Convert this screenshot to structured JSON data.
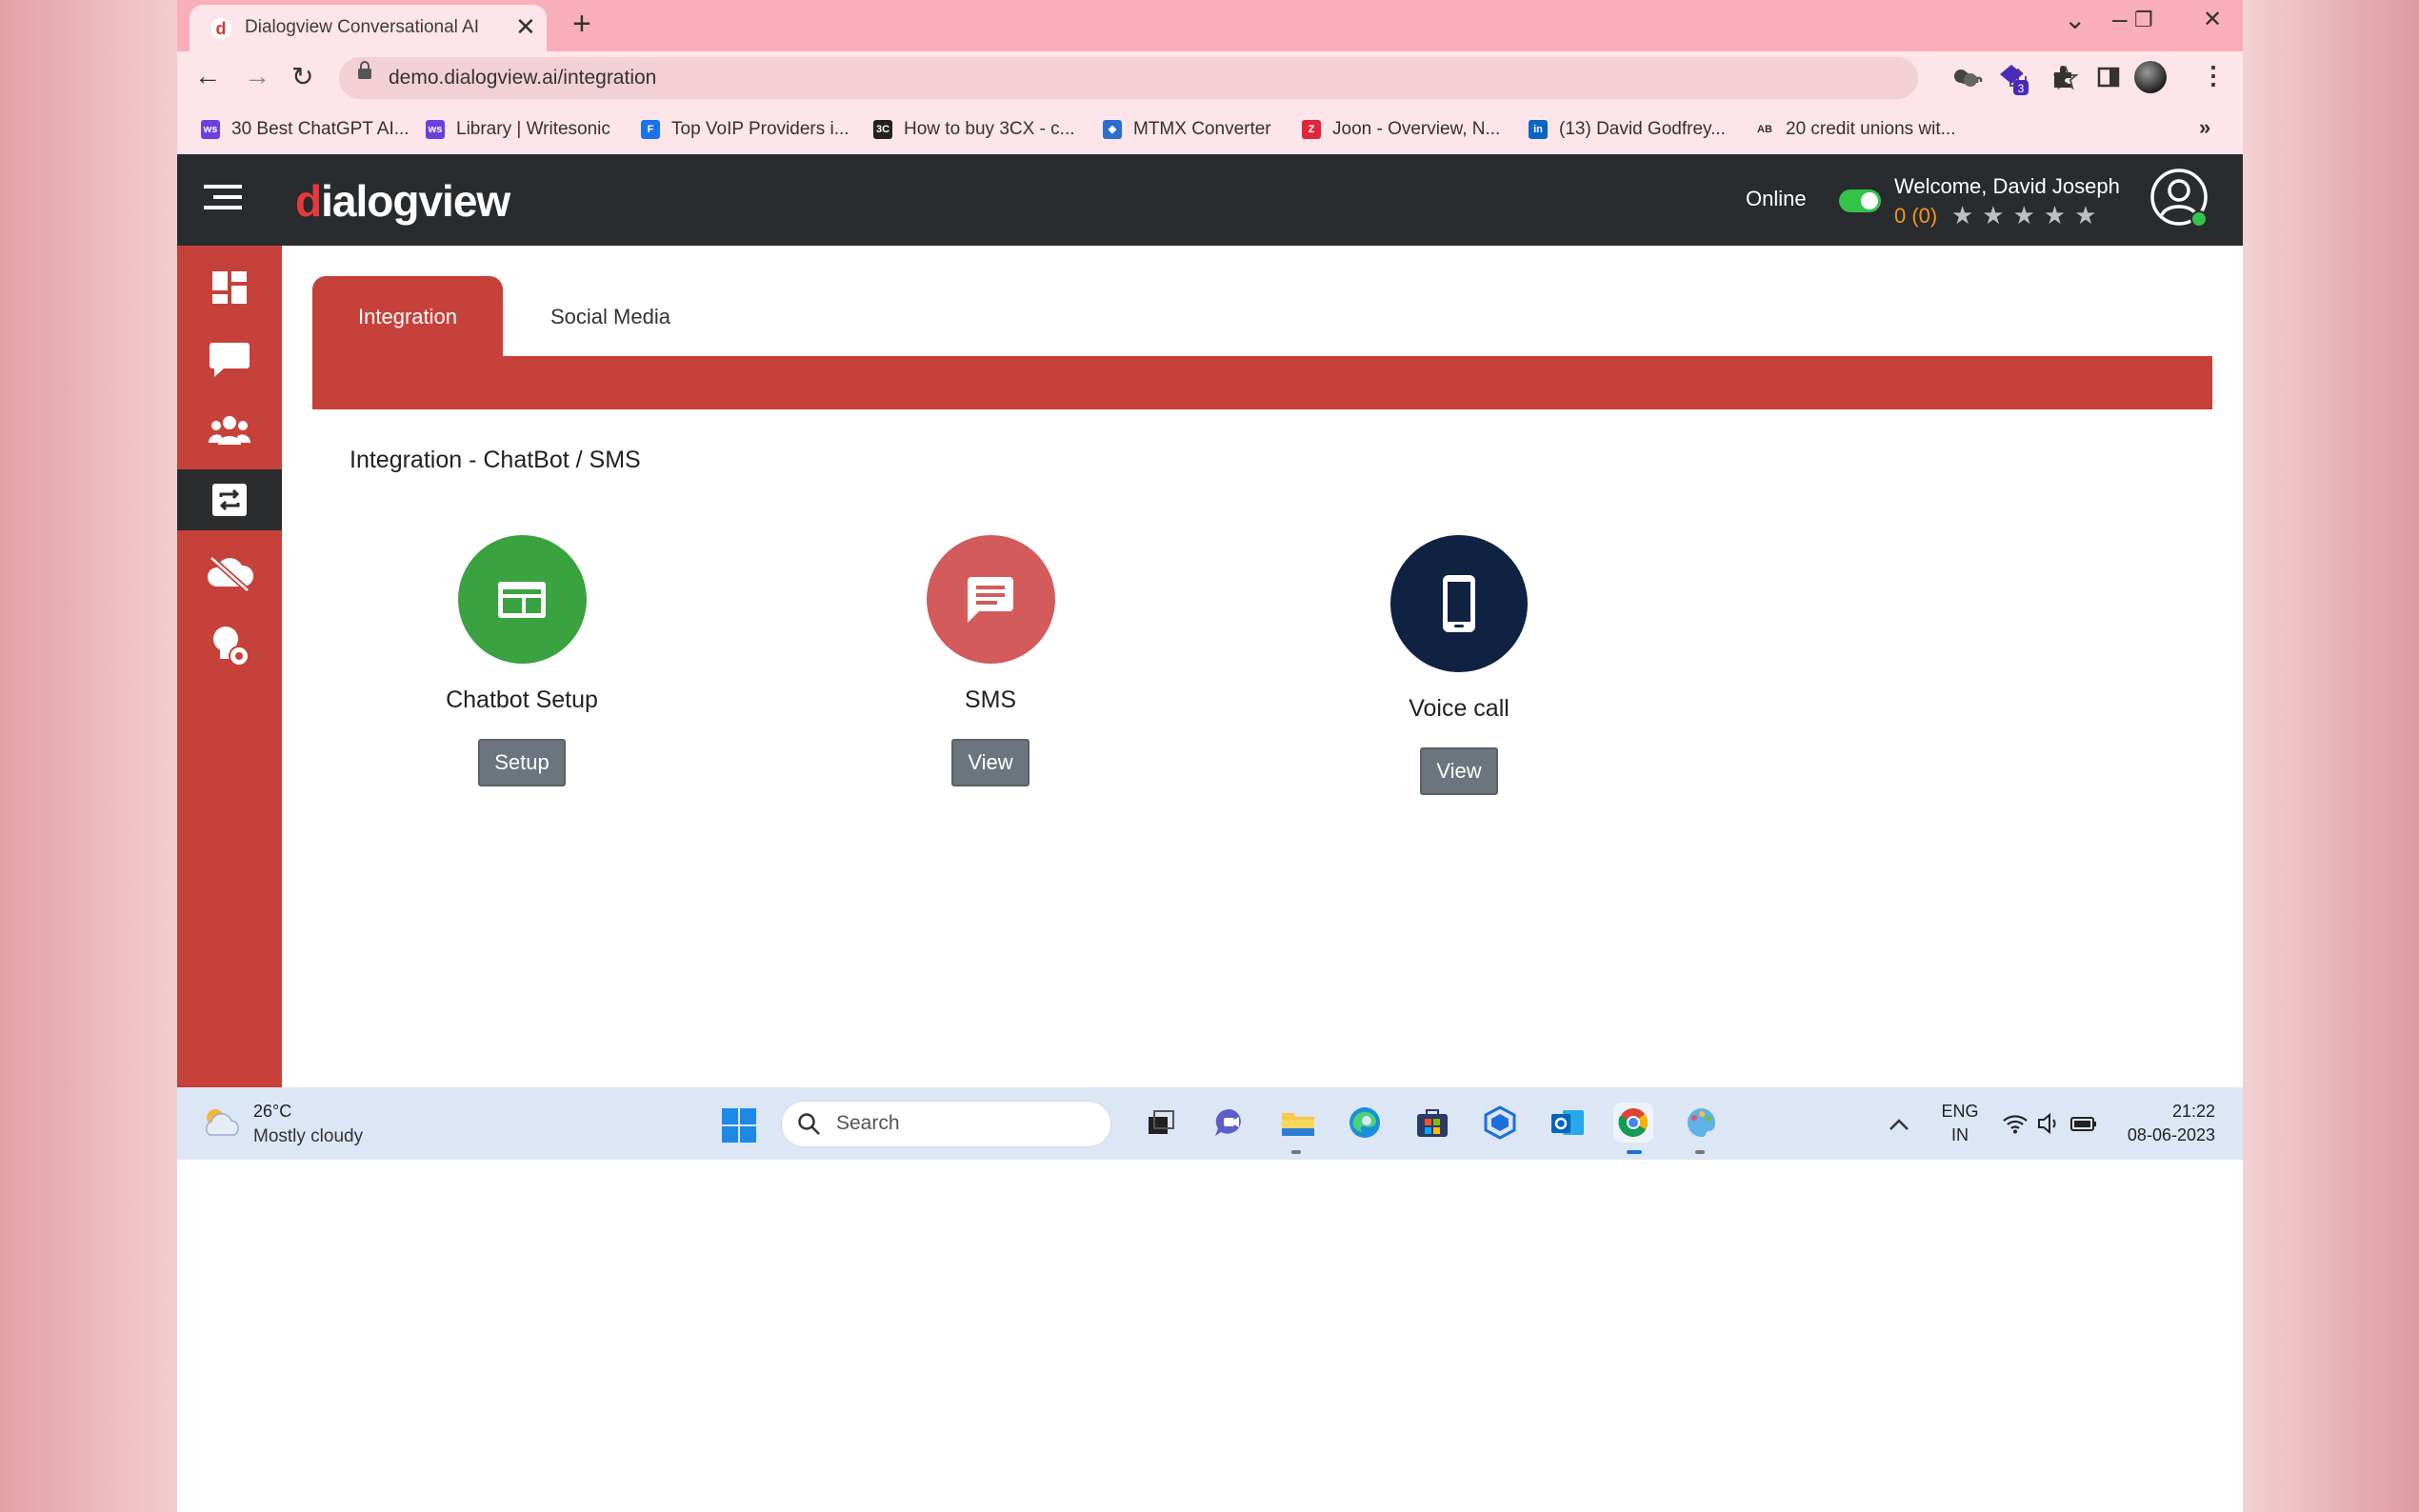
{
  "browser": {
    "tab_title": "Dialogview Conversational AI",
    "tab_close": "✕",
    "new_tab": "+",
    "window_controls": [
      "⌄",
      "–",
      "❐",
      "✕"
    ],
    "nav": {
      "back": "←",
      "forward": "→",
      "reload": "↻"
    },
    "url": "demo.dialogview.ai/integration",
    "omnibox_icons": [
      "key-icon",
      "share-icon",
      "star-icon"
    ],
    "extension_icons": [
      "extension-icon",
      "extension-badge-icon",
      "puzzle-icon",
      "sidepanel-icon",
      "profile-icon",
      "menu-icon"
    ],
    "extension_badge": "3",
    "bookmarks": [
      {
        "label": "30 Best ChatGPT AI...",
        "icon": "writesonic-icon",
        "color": "#6c3fe0"
      },
      {
        "label": "Library | Writesonic",
        "icon": "writesonic-icon",
        "color": "#6c3fe0"
      },
      {
        "label": "Top VoIP Providers i...",
        "icon": "document-icon",
        "color": "#1a73e8"
      },
      {
        "label": "How to buy 3CX - c...",
        "icon": "3cx-icon",
        "color": "#222222"
      },
      {
        "label": "MTMX Converter",
        "icon": "mtmx-icon",
        "color": "#2c6fd1"
      },
      {
        "label": "Joon - Overview, N...",
        "icon": "zoominfo-icon",
        "color": "#e0263b"
      },
      {
        "label": "(13) David Godfrey...",
        "icon": "linkedin-icon",
        "color": "#0a66c2"
      },
      {
        "label": "20 credit unions wit...",
        "icon": "ab-icon",
        "color": "#333333"
      }
    ],
    "bookmarks_more": "»"
  },
  "app": {
    "logo_prefix": "d",
    "logo_rest": "ialogview",
    "status_label": "Online",
    "status_on": true,
    "welcome": "Welcome, David Joseph",
    "rating": "0 (0)",
    "stars": "★★★★★",
    "accent_color": "#c7413b",
    "sidebar_items": [
      {
        "name": "dashboard-icon",
        "active": false
      },
      {
        "name": "chat-icon",
        "active": false
      },
      {
        "name": "users-icon",
        "active": false
      },
      {
        "name": "integration-icon",
        "active": true
      },
      {
        "name": "cloud-off-icon",
        "active": false
      },
      {
        "name": "bulb-settings-icon",
        "active": false
      }
    ]
  },
  "tabs": {
    "integration": "Integration",
    "social_media": "Social Media"
  },
  "section_title": "Integration - ChatBot / SMS",
  "cards": [
    {
      "label": "Chatbot Setup",
      "button": "Setup",
      "icon": "chatbot-icon",
      "color": "#3aa340"
    },
    {
      "label": "SMS",
      "button": "View",
      "icon": "sms-icon",
      "color": "#d35b5b"
    },
    {
      "label": "Voice call",
      "button": "View",
      "icon": "phone-icon",
      "color": "#0f2241"
    }
  ],
  "taskbar": {
    "temperature": "26°C",
    "condition": "Mostly cloudy",
    "search_placeholder": "Search",
    "apps": [
      "task-view-icon",
      "teams-icon",
      "file-explorer-icon",
      "edge-icon",
      "store-icon",
      "vpn-icon",
      "outlook-icon",
      "chrome-icon",
      "paint-icon"
    ],
    "language": "ENG",
    "region": "IN",
    "time": "21:22",
    "date": "08-06-2023"
  }
}
